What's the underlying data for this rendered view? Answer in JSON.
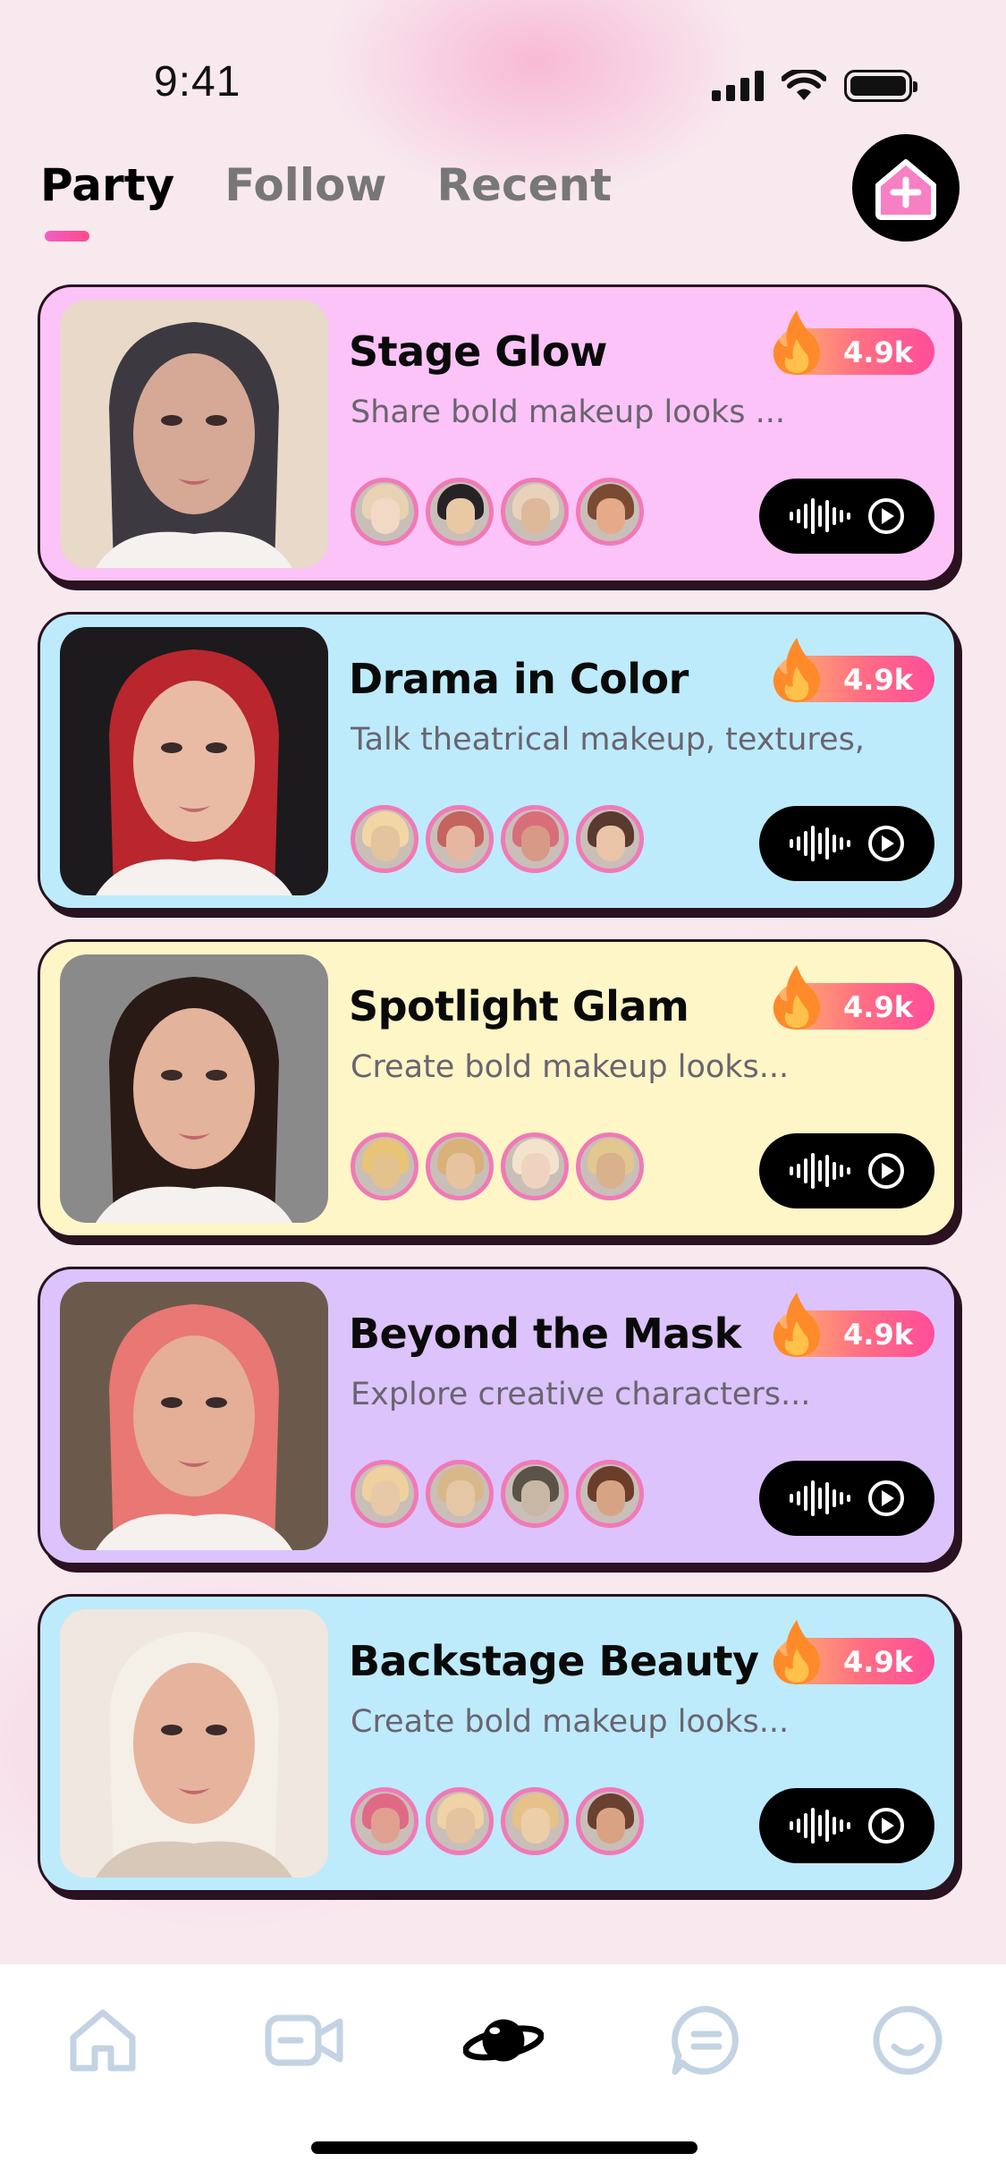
{
  "status_bar": {
    "time": "9:41"
  },
  "tabs": [
    {
      "label": "Party",
      "active": true
    },
    {
      "label": "Follow",
      "active": false
    },
    {
      "label": "Recent",
      "active": false
    }
  ],
  "add_button_icon": "home-plus-icon",
  "rooms": [
    {
      "title": "Stage Glow",
      "description": "Share bold makeup looks ...",
      "count": "4.9k",
      "bg": "#fbc3f7",
      "photo_tones": [
        "#e8d9c8",
        "#d6a896",
        "#3c3a40"
      ]
    },
    {
      "title": "Drama in Color",
      "description": "Talk theatrical makeup, textures,",
      "count": "4.9k",
      "bg": "#bdebfb",
      "photo_tones": [
        "#1c1a1d",
        "#e9bba5",
        "#b9262d"
      ]
    },
    {
      "title": "Spotlight Glam",
      "description": "Create bold makeup looks...",
      "count": "4.9k",
      "bg": "#fef6c7",
      "photo_tones": [
        "#8b8a8b",
        "#e3b39b",
        "#2a1a16"
      ]
    },
    {
      "title": "Beyond the Mask",
      "description": "Explore creative characters...",
      "count": "4.9k",
      "bg": "#dcc3fb",
      "photo_tones": [
        "#6b5a4b",
        "#e4ae97",
        "#e97774"
      ]
    },
    {
      "title": "Backstage Beauty",
      "description": "Create bold makeup looks...",
      "count": "4.9k",
      "bg": "#bdebfb",
      "photo_tones": [
        "#efe7e0",
        "#e6b49c",
        "#f4efe7"
      ]
    }
  ],
  "tab_bar": [
    {
      "icon": "home-icon",
      "active": false
    },
    {
      "icon": "video-camera-icon",
      "active": false
    },
    {
      "icon": "planet-icon",
      "active": true
    },
    {
      "icon": "chat-icon",
      "active": false
    },
    {
      "icon": "smiley-icon",
      "active": false
    }
  ]
}
